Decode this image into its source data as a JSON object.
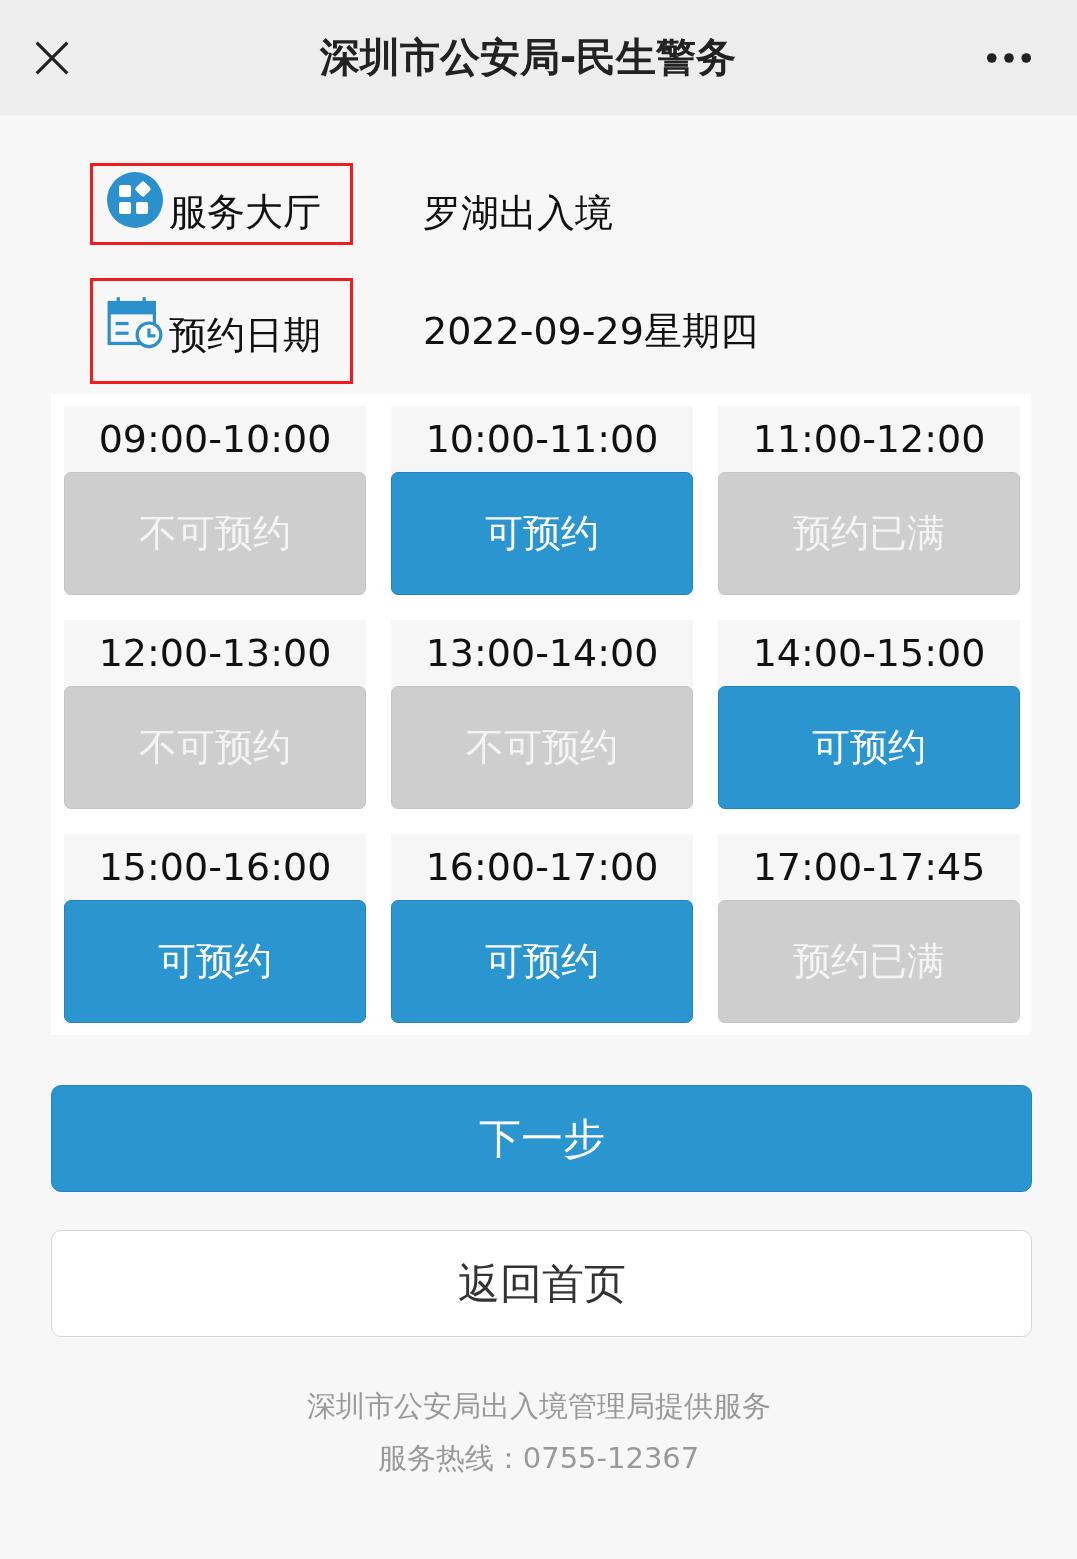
{
  "top_bar": {
    "title": "深圳市公安局-民生警务"
  },
  "info_rows": [
    {
      "label": "服务大厅",
      "value": "罗湖出入境",
      "highlighted": true,
      "kind": "hall"
    },
    {
      "label": "预约日期",
      "value": "2022-09-29星期四",
      "highlighted": true,
      "kind": "date"
    }
  ],
  "slots": [
    {
      "time": "09:00-10:00",
      "status": "不可预约",
      "available": false
    },
    {
      "time": "10:00-11:00",
      "status": "可预约",
      "available": true
    },
    {
      "time": "11:00-12:00",
      "status": "预约已满",
      "available": false
    },
    {
      "time": "12:00-13:00",
      "status": "不可预约",
      "available": false
    },
    {
      "time": "13:00-14:00",
      "status": "不可预约",
      "available": false
    },
    {
      "time": "14:00-15:00",
      "status": "可预约",
      "available": true
    },
    {
      "time": "15:00-16:00",
      "status": "可预约",
      "available": true
    },
    {
      "time": "16:00-17:00",
      "status": "可预约",
      "available": true
    },
    {
      "time": "17:00-17:45",
      "status": "预约已满",
      "available": false
    }
  ],
  "buttons": {
    "next": "下一步",
    "home": "返回首页"
  },
  "footer": {
    "provider": "深圳市公安局出入境管理局提供服务",
    "hotline": "服务热线：0755-12367"
  }
}
